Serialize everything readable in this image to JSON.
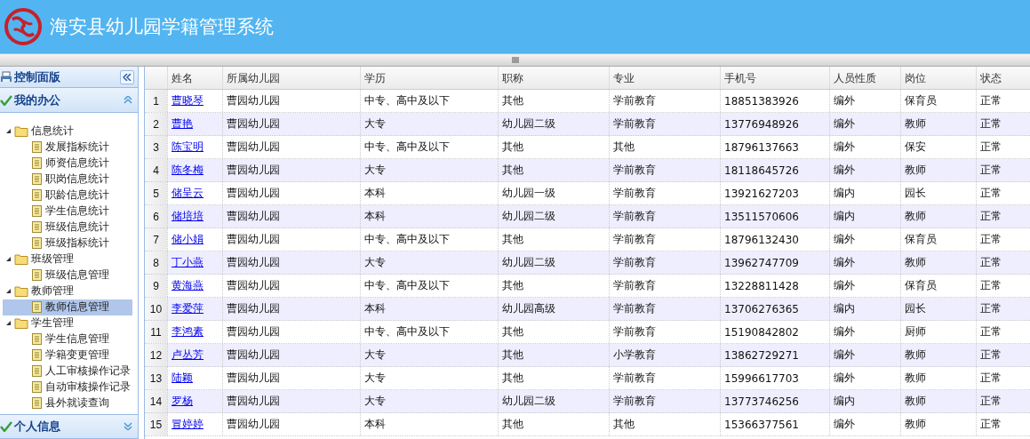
{
  "header": {
    "title": "海安县幼儿园学籍管理系统"
  },
  "sidebar": {
    "title": "控制面版",
    "panels": [
      {
        "title": "我的办公",
        "expanded": true,
        "tree": [
          {
            "label": "信息统计",
            "expanded": true,
            "children": [
              {
                "label": "发展指标统计",
                "selected": false
              },
              {
                "label": "师资信息统计",
                "selected": false
              },
              {
                "label": "职岗信息统计",
                "selected": false
              },
              {
                "label": "职龄信息统计",
                "selected": false
              },
              {
                "label": "学生信息统计",
                "selected": false
              },
              {
                "label": "班级信息统计",
                "selected": false
              },
              {
                "label": "班级指标统计",
                "selected": false
              }
            ]
          },
          {
            "label": "班级管理",
            "expanded": true,
            "children": [
              {
                "label": "班级信息管理",
                "selected": false
              }
            ]
          },
          {
            "label": "教师管理",
            "expanded": true,
            "children": [
              {
                "label": "教师信息管理",
                "selected": true
              }
            ]
          },
          {
            "label": "学生管理",
            "expanded": true,
            "children": [
              {
                "label": "学生信息管理",
                "selected": false
              },
              {
                "label": "学籍变更管理",
                "selected": false
              },
              {
                "label": "人工审核操作记录",
                "selected": false
              },
              {
                "label": "自动审核操作记录",
                "selected": false
              },
              {
                "label": "县外就读查询",
                "selected": false
              }
            ]
          }
        ]
      },
      {
        "title": "个人信息",
        "expanded": false
      }
    ]
  },
  "table": {
    "columns": [
      "姓名",
      "所属幼儿园",
      "学历",
      "职称",
      "专业",
      "手机号",
      "人员性质",
      "岗位",
      "状态"
    ],
    "rows": [
      {
        "number": "1",
        "cells": [
          "曹晓琴",
          "曹园幼儿园",
          "中专、高中及以下",
          "其他",
          "学前教育",
          "18851383926",
          "编外",
          "保育员",
          "正常"
        ]
      },
      {
        "number": "2",
        "cells": [
          "曹艳",
          "曹园幼儿园",
          "大专",
          "幼儿园二级",
          "学前教育",
          "13776948926",
          "编外",
          "教师",
          "正常"
        ]
      },
      {
        "number": "3",
        "cells": [
          "陈宝明",
          "曹园幼儿园",
          "中专、高中及以下",
          "其他",
          "其他",
          "18796137663",
          "编外",
          "保安",
          "正常"
        ]
      },
      {
        "number": "4",
        "cells": [
          "陈冬梅",
          "曹园幼儿园",
          "大专",
          "其他",
          "学前教育",
          "18118645726",
          "编外",
          "教师",
          "正常"
        ]
      },
      {
        "number": "5",
        "cells": [
          "储呈云",
          "曹园幼儿园",
          "本科",
          "幼儿园一级",
          "学前教育",
          "13921627203",
          "编内",
          "园长",
          "正常"
        ]
      },
      {
        "number": "6",
        "cells": [
          "储培培",
          "曹园幼儿园",
          "本科",
          "幼儿园二级",
          "学前教育",
          "13511570606",
          "编内",
          "教师",
          "正常"
        ]
      },
      {
        "number": "7",
        "cells": [
          "储小娟",
          "曹园幼儿园",
          "中专、高中及以下",
          "其他",
          "学前教育",
          "18796132430",
          "编外",
          "保育员",
          "正常"
        ]
      },
      {
        "number": "8",
        "cells": [
          "丁小燕",
          "曹园幼儿园",
          "大专",
          "幼儿园二级",
          "学前教育",
          "13962747709",
          "编外",
          "教师",
          "正常"
        ]
      },
      {
        "number": "9",
        "cells": [
          "黄海燕",
          "曹园幼儿园",
          "中专、高中及以下",
          "其他",
          "学前教育",
          "13228811428",
          "编外",
          "保育员",
          "正常"
        ]
      },
      {
        "number": "10",
        "cells": [
          "李爱萍",
          "曹园幼儿园",
          "本科",
          "幼儿园高级",
          "学前教育",
          "13706276365",
          "编内",
          "园长",
          "正常"
        ]
      },
      {
        "number": "11",
        "cells": [
          "李鸿素",
          "曹园幼儿园",
          "中专、高中及以下",
          "其他",
          "学前教育",
          "15190842802",
          "编外",
          "厨师",
          "正常"
        ]
      },
      {
        "number": "12",
        "cells": [
          "卢丛芳",
          "曹园幼儿园",
          "大专",
          "其他",
          "小学教育",
          "13862729271",
          "编外",
          "教师",
          "正常"
        ]
      },
      {
        "number": "13",
        "cells": [
          "陆颖",
          "曹园幼儿园",
          "大专",
          "其他",
          "学前教育",
          "15996617703",
          "编外",
          "教师",
          "正常"
        ]
      },
      {
        "number": "14",
        "cells": [
          "罗杨",
          "曹园幼儿园",
          "大专",
          "幼儿园二级",
          "学前教育",
          "13773746256",
          "编内",
          "教师",
          "正常"
        ]
      },
      {
        "number": "15",
        "cells": [
          "冒婷婷",
          "曹园幼儿园",
          "本科",
          "其他",
          "其他",
          "15366377561",
          "编外",
          "教师",
          "正常"
        ]
      }
    ]
  }
}
